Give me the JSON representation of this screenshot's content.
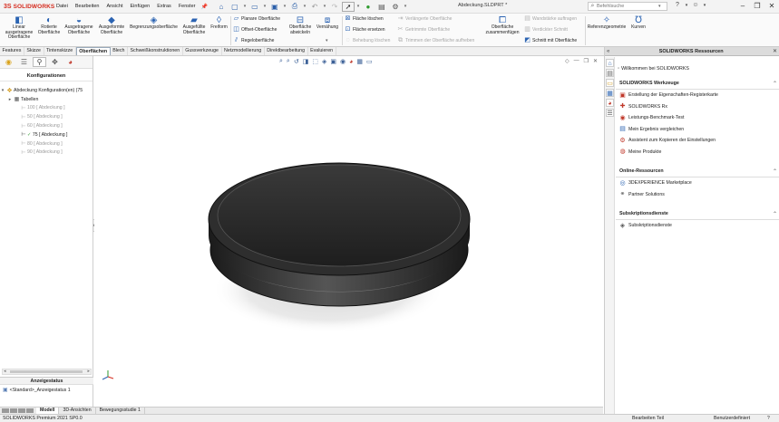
{
  "app": {
    "logo_ds": "3S",
    "logo_text": "SOLIDWORKS",
    "menu": [
      "Datei",
      "Bearbeiten",
      "Ansicht",
      "Einfügen",
      "Extras",
      "Fenster"
    ],
    "document_title": "Abdeckung.SLDPRT *",
    "search_placeholder": "Befehlsuche"
  },
  "ribbon": {
    "buttons": [
      {
        "label": "Linear\nausgetragene\nOberfläche",
        "icon": "linear-surface-icon"
      },
      {
        "label": "Rotierte\nOberfläche",
        "icon": "revolve-surface-icon"
      },
      {
        "label": "Ausgetragene\nOberfläche",
        "icon": "swept-surface-icon"
      },
      {
        "label": "Ausgeformte\nOberfläche",
        "icon": "loft-surface-icon"
      },
      {
        "label": "Begrenzungsoberfläche",
        "icon": "boundary-surface-icon"
      },
      {
        "label": "Ausgefüllte\nOberfläche",
        "icon": "filled-surface-icon"
      },
      {
        "label": "Freiform",
        "icon": "freeform-icon"
      }
    ],
    "group1": [
      "Planare Oberfläche",
      "Offset-Oberfläche",
      "Regeloberfläche"
    ],
    "flatten": "Oberfläche\nabwickeln",
    "knit": "Vernähung",
    "group2": [
      "Fläche löschen",
      "Fläche ersetzen",
      "Behebung löschen"
    ],
    "group3": [
      "Verlängerte Oberfläche",
      "Getrimmte Oberfläche",
      "Trimmen der Oberfläche aufheben"
    ],
    "untrim": "Oberfläche\nzusammenfügen",
    "group4": [
      "Wandstärke auftragen",
      "Verdickter Schnitt",
      "Schnitt mit Oberfläche"
    ],
    "ref_geom": "Referenzgeometrie",
    "curves": "Kurven"
  },
  "tabs": [
    "Features",
    "Skizze",
    "Tintenskizze",
    "Oberflächen",
    "Blech",
    "Schweißkonstruktionen",
    "Gussverkzeuge",
    "Netzmodellierung",
    "Direktbearbeitung",
    "Evaluieren"
  ],
  "left_panel": {
    "header": "Konfigurationen",
    "root": "Abdeckung Konfiguration(en)  (75",
    "tables": "Tabellen",
    "configs": [
      {
        "label": "100 [ Abdeckung ]",
        "active": false
      },
      {
        "label": "50 [ Abdeckung ]",
        "active": false
      },
      {
        "label": "60 [ Abdeckung ]",
        "active": false
      },
      {
        "label": "75 [ Abdeckung ]",
        "active": true
      },
      {
        "label": "80 [ Abdeckung ]",
        "active": false
      },
      {
        "label": "90 [ Abdeckung ]",
        "active": false
      }
    ],
    "display_state_header": "Anzeigestatus",
    "display_state": "<Standard>_Anzeigestatus 1"
  },
  "bottom_tabs": [
    "Modell",
    "3D-Ansichten",
    "Bewegungsstudie 1"
  ],
  "status": {
    "left": "SOLIDWORKS Premium 2021 SP0.0",
    "mode": "Bearbeiten Teil",
    "units": "Benutzerdefiniert",
    "help": "?"
  },
  "resources": {
    "title": "SOLIDWORKS Ressourcen",
    "welcome": "Willkommen bei SOLIDWORKS",
    "sections": [
      {
        "title": "SOLIDWORKS Werkzeuge",
        "items": [
          "Erstellung der Eigenschaften-Registerkarte",
          "SOLIDWORKS Rx",
          "Leistungs-Benchmark-Test",
          "Mein Ergebnis vergleichen",
          "Assistent zum Kopieren der Einstellungen",
          "Meine Produkte"
        ]
      },
      {
        "title": "Online-Ressourcen",
        "items": [
          "3DEXPERIENCE Marketplace",
          "Partner Solutions"
        ]
      },
      {
        "title": "Subskriptionsdienste",
        "items": [
          "Subskriptionsdienste"
        ]
      }
    ]
  },
  "colors": {
    "accent": "#2b63b2",
    "brand": "#d52b1e",
    "model": "#2b2b2b"
  }
}
